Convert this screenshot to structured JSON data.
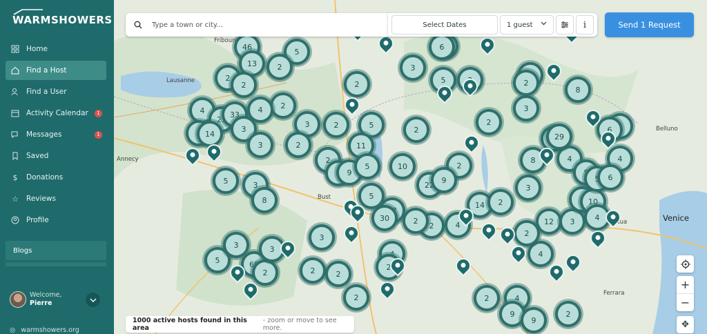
{
  "brand": {
    "name": "WARMSHOWERS"
  },
  "nav": {
    "items": [
      {
        "label": "Home",
        "icon": "home-icon"
      },
      {
        "label": "Find a Host",
        "icon": "house-search-icon",
        "active": true
      },
      {
        "label": "Find a User",
        "icon": "user-search-icon"
      },
      {
        "label": "Activity Calendar",
        "icon": "calendar-icon",
        "badge": "1"
      },
      {
        "label": "Messages",
        "icon": "messages-icon",
        "badge": "1"
      },
      {
        "label": "Saved",
        "icon": "bookmark-icon"
      },
      {
        "label": "Donations",
        "icon": "dollar-icon"
      },
      {
        "label": "Reviews",
        "icon": "star-icon"
      },
      {
        "label": "Profile",
        "icon": "profile-icon"
      }
    ],
    "blogs": "Blogs"
  },
  "user": {
    "welcome": "Welcome,",
    "name": "Pierre"
  },
  "site_link": "warmshowers.org",
  "search": {
    "placeholder": "Type a town or city...",
    "dates": "Select Dates",
    "guests": "1 guest"
  },
  "send_button": "Send 1 Request",
  "status": {
    "count_text": "1000 active hosts found in this area",
    "hint": "- zoom or move to see more."
  },
  "towns": {
    "venice": "Venice",
    "lausanne": "Lausanne",
    "annecy": "Annecy",
    "ferrara": "Ferrara",
    "belluno": "Belluno",
    "padua": "adua",
    "fribourg": "Fribourg",
    "bust": "Bust"
  },
  "clusters": [
    "46",
    "5",
    "13",
    "2",
    "2",
    "2",
    "2",
    "4",
    "2",
    "4",
    "21",
    "33",
    "3",
    "7",
    "14",
    "3",
    "3",
    "2",
    "5",
    "2",
    "2",
    "11",
    "2",
    "3",
    "10",
    "2",
    "22",
    "9",
    "2",
    "9",
    "5",
    "5",
    "3",
    "8",
    "5",
    "37",
    "30",
    "6",
    "3",
    "2",
    "5",
    "5",
    "8",
    "14",
    "2",
    "2",
    "8",
    "4",
    "4",
    "12",
    "3",
    "5",
    "3",
    "10",
    "4",
    "5",
    "6",
    "2",
    "3",
    "2",
    "4",
    "2",
    "2",
    "5",
    "3",
    "69",
    "2",
    "3",
    "3",
    "2",
    "2",
    "4",
    "4",
    "4",
    "9",
    "9",
    "8",
    "29",
    "3",
    "2",
    "6",
    "2",
    "2",
    "2",
    "2"
  ],
  "colors": {
    "sidebar": "#1f6b6b",
    "accent": "#3a90e0",
    "cluster_fill": "#b9ddd8"
  }
}
